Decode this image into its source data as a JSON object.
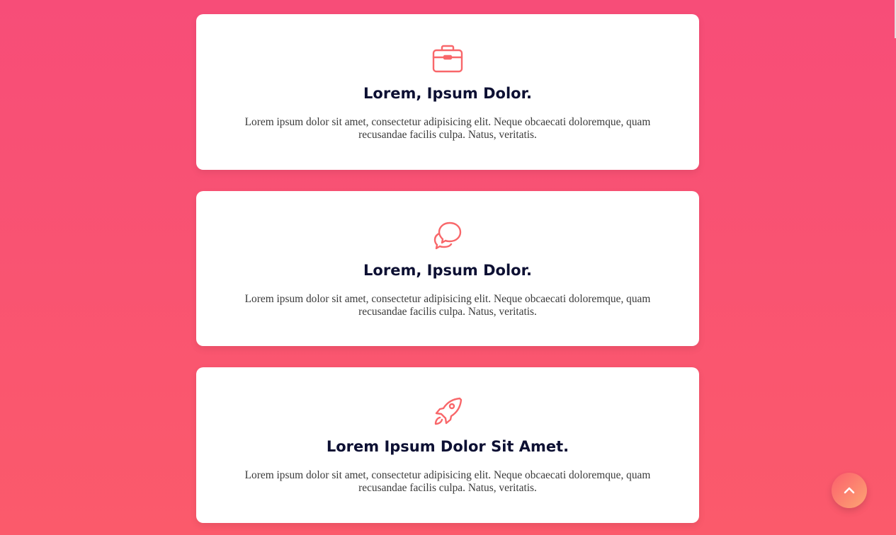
{
  "cards": [
    {
      "icon": "briefcase-icon",
      "title": "Lorem, Ipsum Dolor.",
      "text": "Lorem ipsum dolor sit amet, consectetur adipisicing elit. Neque obcaecati doloremque, quam recusandae facilis culpa. Natus, veritatis."
    },
    {
      "icon": "chat-bubbles-icon",
      "title": "Lorem, Ipsum Dolor.",
      "text": "Lorem ipsum dolor sit amet, consectetur adipisicing elit. Neque obcaecati doloremque, quam recusandae facilis culpa. Natus, veritatis."
    },
    {
      "icon": "rocket-icon",
      "title": "Lorem Ipsum Dolor Sit Amet.",
      "text": "Lorem ipsum dolor sit amet, consectetur adipisicing elit. Neque obcaecati doloremque, quam recusandae facilis culpa. Natus, veritatis."
    }
  ],
  "scroll_top": {
    "icon": "chevron-up-icon"
  },
  "colors": {
    "background_top": "#f74d78",
    "background_bottom": "#fb5a6b",
    "card": "#ffffff",
    "icon_accent": "#f8676a",
    "title": "#0d1033",
    "body_text": "#3a3a3a",
    "button_start": "#fb5f6c",
    "button_end": "#fda573"
  }
}
